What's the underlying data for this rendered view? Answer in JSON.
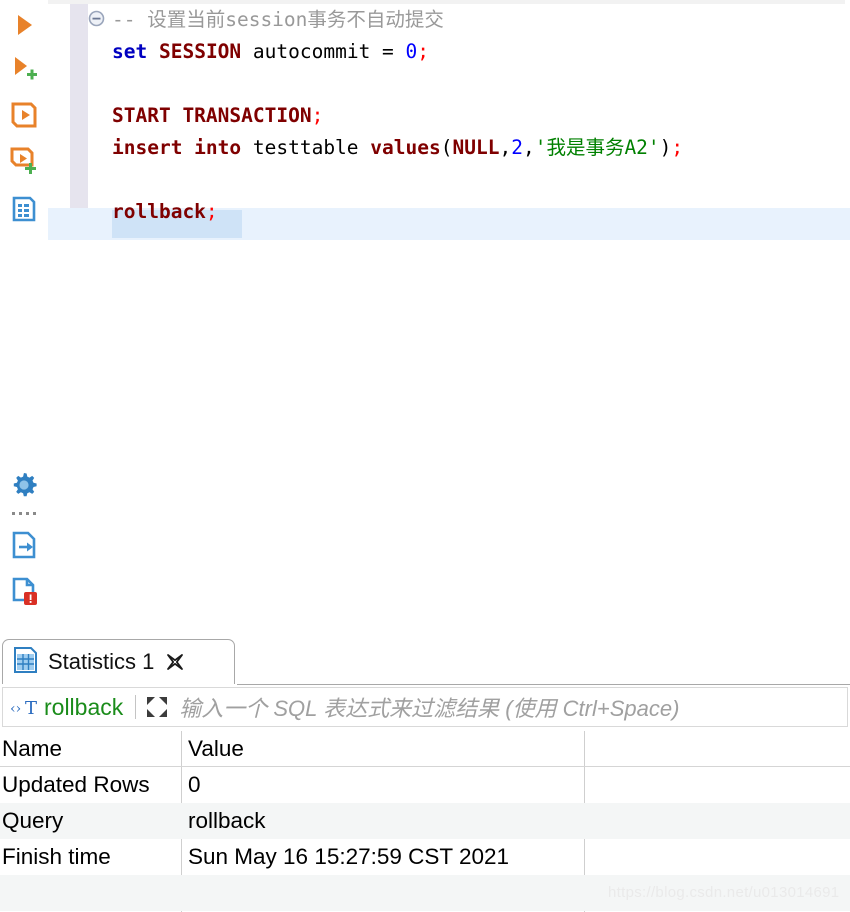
{
  "toolbar": {
    "buttons": [
      {
        "name": "execute-statement",
        "icon": "play-icon"
      },
      {
        "name": "execute-statement-new-tab",
        "icon": "play-plus-icon"
      },
      {
        "name": "execute-script",
        "icon": "script-execute-icon"
      },
      {
        "name": "execute-script-new-tab",
        "icon": "script-execute-plus-icon"
      },
      {
        "name": "execute-statistics",
        "icon": "statistics-grid-icon"
      },
      {
        "name": "sql-editor-settings",
        "icon": "gear-icon"
      },
      {
        "name": "export-from-query",
        "icon": "document-export-icon"
      },
      {
        "name": "show-errors",
        "icon": "document-error-icon"
      }
    ]
  },
  "editor": {
    "lines": [
      {
        "fold": true,
        "tokens": [
          {
            "text": "-- 设置当前session事务不自动提交",
            "cls": "comment"
          }
        ]
      },
      {
        "tokens": [
          {
            "text": "set",
            "cls": "kw-blue"
          },
          {
            "text": " ",
            "cls": "plain"
          },
          {
            "text": "SESSION",
            "cls": "kw-red"
          },
          {
            "text": " autocommit = ",
            "cls": "plain"
          },
          {
            "text": "0",
            "cls": "num"
          },
          {
            "text": ";",
            "cls": "semi"
          }
        ]
      },
      {
        "tokens": []
      },
      {
        "tokens": [
          {
            "text": "START TRANSACTION",
            "cls": "kw-red"
          },
          {
            "text": ";",
            "cls": "semi"
          }
        ]
      },
      {
        "tokens": [
          {
            "text": "insert into",
            "cls": "kw-red"
          },
          {
            "text": " testtable ",
            "cls": "plain"
          },
          {
            "text": "values",
            "cls": "kw-red"
          },
          {
            "text": "(",
            "cls": "plain"
          },
          {
            "text": "NULL",
            "cls": "kw-red"
          },
          {
            "text": ",",
            "cls": "plain"
          },
          {
            "text": "2",
            "cls": "num"
          },
          {
            "text": ",",
            "cls": "plain"
          },
          {
            "text": "'我是事务A2'",
            "cls": "str"
          },
          {
            "text": ")",
            "cls": "plain"
          },
          {
            "text": ";",
            "cls": "semi"
          }
        ]
      },
      {
        "tokens": []
      },
      {
        "current": true,
        "tokens": [
          {
            "text": "rollback",
            "cls": "kw-red"
          },
          {
            "text": ";",
            "cls": "semi"
          }
        ]
      }
    ]
  },
  "results": {
    "tab": {
      "label": "Statistics 1",
      "icon": "statistics-grid-icon",
      "close_icon": "close-icon"
    },
    "filter": {
      "type_icon": "sql-text-icon",
      "query": "rollback",
      "expand_icon": "maximize-icon",
      "placeholder": "输入一个 SQL 表达式来过滤结果 (使用 Ctrl+Space)"
    },
    "table": {
      "columns": [
        "Name",
        "Value",
        ""
      ],
      "rows": [
        {
          "name": "Updated Rows",
          "value": "0"
        },
        {
          "name": "Query",
          "value": "rollback"
        },
        {
          "name": "Finish time",
          "value": "Sun May 16 15:27:59 CST 2021"
        },
        {
          "name": "",
          "value": ""
        }
      ]
    }
  },
  "watermark": "https://blog.csdn.net/u013014691",
  "colors": {
    "keyword_red": "#7f0000",
    "keyword_blue": "#0000c0",
    "string_green": "#008000",
    "number_blue": "#0000ff",
    "semicolon_red": "#ff0000",
    "comment_gray": "#999999",
    "current_line": "#e8f2fd",
    "selection": "#cfe3f7",
    "accent_orange": "#e8822a",
    "accent_blue": "#3d8fd1",
    "error_red": "#d93025",
    "green_plus": "#4caf50"
  }
}
